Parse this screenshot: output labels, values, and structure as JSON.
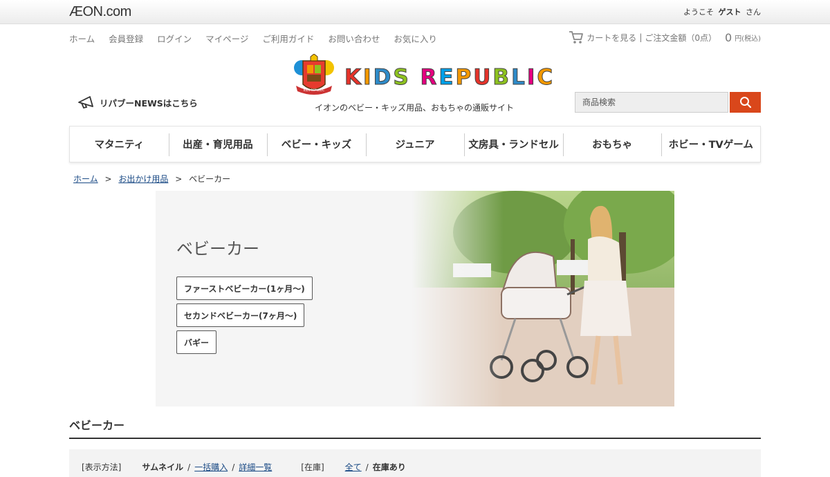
{
  "header": {
    "logo": "ÆON.com",
    "welcome_prefix": "ようこそ",
    "welcome_user": "ゲスト",
    "welcome_suffix": "さん"
  },
  "subnav": [
    "ホーム",
    "会員登録",
    "ログイン",
    "マイページ",
    "ご利用ガイド",
    "お問い合わせ",
    "お気に入り"
  ],
  "cart": {
    "view_label": "カートを見る",
    "order_label": "ご注文金額（0点）",
    "total": "0",
    "unit": "円(税込)",
    "separator": "|"
  },
  "brand": {
    "letters": [
      "K",
      "I",
      "D",
      "S",
      " ",
      "R",
      "E",
      "P",
      "U",
      "B",
      "L",
      "I",
      "C"
    ],
    "crest_text": "KIDS REPUBLIC",
    "tagline": "イオンのベビー・キッズ用品、おもちゃの通販サイト"
  },
  "news_link": "リパブーNEWSはこちら",
  "search": {
    "placeholder": "商品検索"
  },
  "categories": [
    "マタニティ",
    "出産・育児用品",
    "ベビー・キッズ",
    "ジュニア",
    "文房具・ランドセル",
    "おもちゃ",
    "ホビー・TVゲーム"
  ],
  "breadcrumb": {
    "home": "ホーム",
    "parent": "お出かけ用品",
    "current": "ベビーカー",
    "sep": ">"
  },
  "banner": {
    "title": "ベビーカー",
    "subcategories": [
      "ファーストベビーカー(1ヶ月〜)",
      "セカンドベビーカー(7ヶ月〜)",
      "バギー"
    ]
  },
  "section_title": "ベビーカー",
  "toolbar": {
    "display_label": "[表示方法]",
    "display_options": [
      "サムネイル",
      "一括購入",
      "詳細一覧"
    ],
    "stock_label": "[在庫]",
    "stock_options": [
      "全て",
      "在庫あり"
    ]
  },
  "colors": {
    "accent": "#d9471b",
    "link": "#1a4a85",
    "brand_letters": [
      "#e6332a",
      "#f39800",
      "#2e8bc9",
      "#8dc21f",
      "#ffffff",
      "#e4007f",
      "#00a0e9",
      "#f39800",
      "#e6332a",
      "#8dc21f",
      "#2e8bc9",
      "#e4007f",
      "#f39800"
    ]
  }
}
